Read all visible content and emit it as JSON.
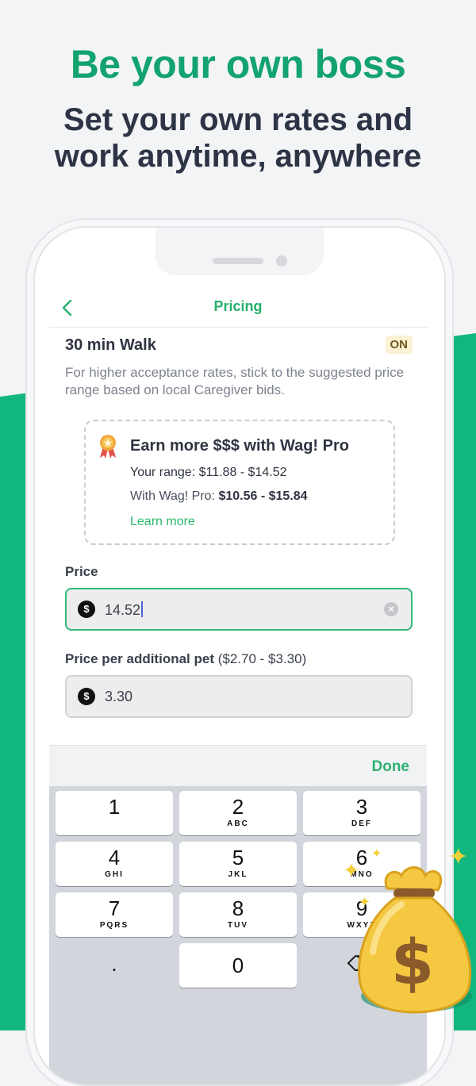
{
  "marketing": {
    "headline": "Be your own boss",
    "subline_1": "Set your own rates and",
    "subline_2": "work anytime, anywhere"
  },
  "nav": {
    "title": "Pricing",
    "back_icon": "chevron-left-icon"
  },
  "service": {
    "title": "30 min Walk",
    "status": "ON",
    "hint": "For higher acceptance rates, stick to the suggested price range based on local Caregiver bids."
  },
  "promo": {
    "icon": "award-ribbon-icon",
    "title": "Earn more $$$ with Wag! Pro",
    "range_label": "Your range: $11.88 - $14.52",
    "pro_label": "With Wag! Pro:",
    "pro_range": "$10.56 - $15.84",
    "learn_more": "Learn more"
  },
  "price": {
    "label": "Price",
    "currency_symbol": "$",
    "value": "14.52"
  },
  "additional_pet": {
    "label": "Price per additional pet",
    "range": "($2.70 - $3.30)",
    "currency_symbol": "$",
    "value": "3.30"
  },
  "keyboard": {
    "done": "Done",
    "keys": [
      {
        "num": "1",
        "letters": ""
      },
      {
        "num": "2",
        "letters": "ABC"
      },
      {
        "num": "3",
        "letters": "DEF"
      },
      {
        "num": "4",
        "letters": "GHI"
      },
      {
        "num": "5",
        "letters": "JKL"
      },
      {
        "num": "6",
        "letters": "MNO"
      },
      {
        "num": "7",
        "letters": "PQRS"
      },
      {
        "num": "8",
        "letters": "TUV"
      },
      {
        "num": "9",
        "letters": "WXYZ"
      },
      {
        "num": ".",
        "letters": ""
      },
      {
        "num": "0",
        "letters": ""
      },
      {
        "num": "⌫",
        "letters": ""
      }
    ]
  },
  "colors": {
    "brand_green": "#12b77f",
    "headline_green": "#12a36f",
    "accent_green": "#26b06b",
    "dark_text": "#2d3446"
  }
}
